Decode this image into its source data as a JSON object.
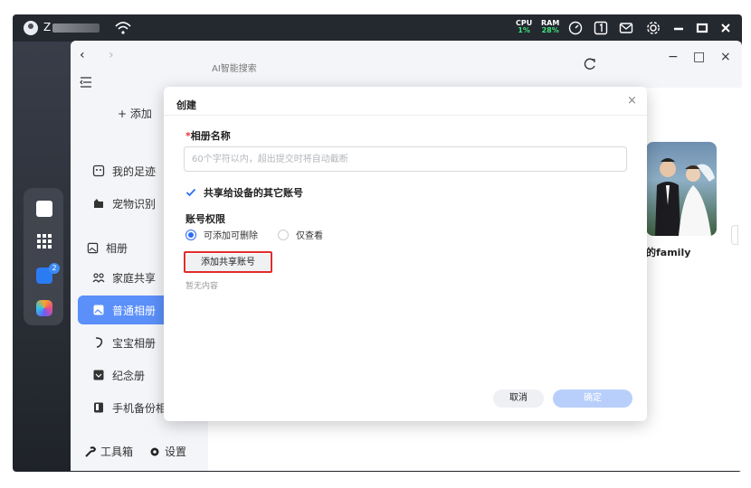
{
  "topbar": {
    "username": "Z",
    "cpu_label": "CPU",
    "cpu_value": "1%",
    "ram_label": "RAM",
    "ram_value": "28%",
    "icons": [
      "wifi-icon",
      "speed-icon",
      "one-icon",
      "mail-icon",
      "gear-icon",
      "minimize-icon",
      "maximize-icon",
      "close-icon"
    ]
  },
  "window": {
    "search_placeholder": "AI智能搜索",
    "minimize": "−",
    "maximize": "□",
    "close": "×"
  },
  "sidebar": {
    "back": "‹",
    "forward": "›",
    "add_label": "+ 添加",
    "items": [
      {
        "label": "我的足迹",
        "icon": "footprint-icon"
      },
      {
        "label": "宠物识别",
        "icon": "pet-icon"
      }
    ],
    "album_heading": "相册",
    "album_items": [
      {
        "label": "家庭共享",
        "icon": "family-icon"
      },
      {
        "label": "普通相册",
        "icon": "album-icon",
        "active": true
      },
      {
        "label": "宝宝相册",
        "icon": "baby-icon"
      },
      {
        "label": "纪念册",
        "icon": "memorial-icon"
      },
      {
        "label": "手机备份相",
        "icon": "phone-backup-icon"
      }
    ],
    "footer_toolbox": "工具箱",
    "footer_settings": "设置"
  },
  "main": {
    "album_card_label": "的family"
  },
  "dock": {
    "badge": "2"
  },
  "dialog": {
    "title": "创建",
    "close": "×",
    "name_required": "*",
    "name_label": "相册名称",
    "name_placeholder": "60个字符以内，超出提交时将自动截断",
    "share_checkbox": "共享给设备的其它账号",
    "permission_label": "账号权限",
    "perm_options": [
      "可添加可删除",
      "仅查看"
    ],
    "perm_selected": "可添加可删除",
    "add_share_button": "添加共享账号",
    "empty_text": "暂无内容",
    "cancel": "取消",
    "confirm": "确定"
  },
  "colors": {
    "accent": "#5b8ff9",
    "primary": "#2f6cf6",
    "highlight_border": "#e02d2d",
    "confirm_disabled": "#b9cffb"
  }
}
